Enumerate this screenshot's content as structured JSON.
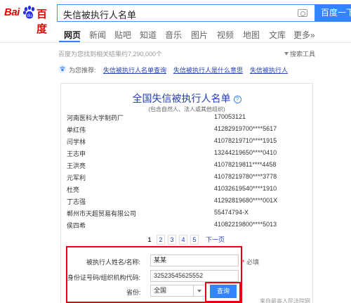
{
  "header": {
    "logo_bai": "Bai",
    "logo_du": "百度",
    "query": "失信被执行人名单",
    "search_button": "百度一下"
  },
  "nav": {
    "tabs": [
      "网页",
      "新闻",
      "贴吧",
      "知道",
      "音乐",
      "图片",
      "视频",
      "地图",
      "文库",
      "更多»"
    ],
    "active_tab": "网页"
  },
  "results": {
    "count_text": "百度为您找到相关结果约7,290,000个",
    "search_tools": "搜索工具"
  },
  "recommend": {
    "label": "为您推荐:",
    "links": [
      "失信被执行人名单查询",
      "失信被执行人是什么意思",
      "失信被执行人"
    ]
  },
  "card": {
    "title": "全国失信被执行人名单",
    "help_icon": "?",
    "subtitle": "(包含自然人、法人或其他组织)",
    "rows": [
      {
        "name": "河南医科大学制药厂",
        "code": "170053121"
      },
      {
        "name": "单红伟",
        "code": "41282919700****5617"
      },
      {
        "name": "闫学林",
        "code": "41078219710****1915"
      },
      {
        "name": "王志申",
        "code": "13244219650****0410"
      },
      {
        "name": "王洪亮",
        "code": "41078219811****4458"
      },
      {
        "name": "元军利",
        "code": "41078219780****3778"
      },
      {
        "name": "杜亮",
        "code": "41032619540****1910"
      },
      {
        "name": "丁志强",
        "code": "41292819680****001X"
      },
      {
        "name": "郸州市天超贸易有限公司",
        "code": "55474794-X"
      },
      {
        "name": "侯四希",
        "code": "41082219800****5013"
      }
    ],
    "pages": [
      "1",
      "2",
      "3",
      "4",
      "5"
    ],
    "next_page": "下一页"
  },
  "form": {
    "name_label": "被执行人姓名/名称:",
    "name_value": "某某",
    "required_star": "*",
    "required_text": "必填",
    "id_label": "身份证号码/组织机构代码:",
    "id_value": "32523545625552",
    "province_label": "省份:",
    "province_value": "全国",
    "query_button": "查询"
  },
  "source_note": "来自最高人民法院网",
  "colors": {
    "brand_red": "#e10602",
    "accent_blue": "#3385ff",
    "link_blue": "#2440b3",
    "annotation_red": "#e60012"
  }
}
